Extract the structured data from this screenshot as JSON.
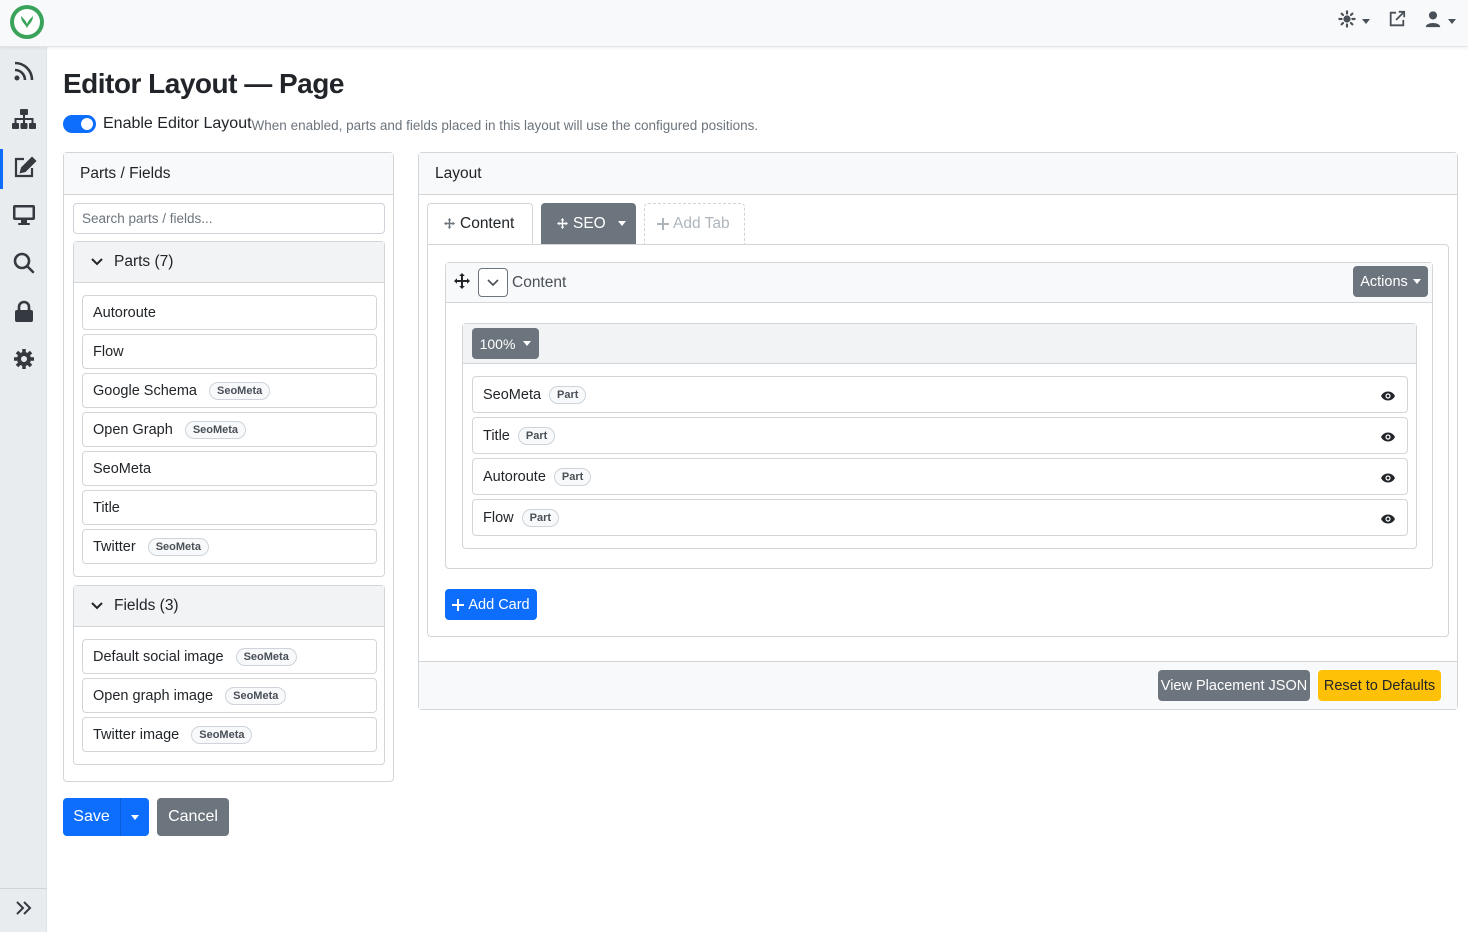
{
  "header": {
    "logo_icon": "orchard-logo-icon",
    "theme_icon": "theme-gear-icon",
    "external_icon": "external-link-icon",
    "user_icon": "user-icon"
  },
  "sidebar": {
    "items": [
      {
        "icon": "rss-icon"
      },
      {
        "icon": "sitemap-icon"
      },
      {
        "icon": "edit-icon",
        "active": true
      },
      {
        "icon": "desktop-icon"
      },
      {
        "icon": "search-icon"
      },
      {
        "icon": "lock-icon"
      },
      {
        "icon": "gear-icon"
      }
    ],
    "expand_icon": "double-chevron-right-icon"
  },
  "page": {
    "title": "Editor Layout — Page",
    "toggle_label": "Enable Editor Layout",
    "toggle_help": "When enabled, parts and fields placed in this layout will use the configured positions.",
    "toggle_on": true
  },
  "left_panel": {
    "title": "Parts / Fields",
    "search_placeholder": "Search parts / fields...",
    "parts_group": {
      "label": "Parts (7)",
      "items": [
        {
          "name": "Autoroute",
          "badge": ""
        },
        {
          "name": "Flow",
          "badge": ""
        },
        {
          "name": "Google Schema",
          "badge": "SeoMeta"
        },
        {
          "name": "Open Graph",
          "badge": "SeoMeta"
        },
        {
          "name": "SeoMeta",
          "badge": ""
        },
        {
          "name": "Title",
          "badge": ""
        },
        {
          "name": "Twitter",
          "badge": "SeoMeta"
        }
      ]
    },
    "fields_group": {
      "label": "Fields (3)",
      "items": [
        {
          "name": "Default social image",
          "badge": "SeoMeta"
        },
        {
          "name": "Open graph image",
          "badge": "SeoMeta"
        },
        {
          "name": "Twitter image",
          "badge": "SeoMeta"
        }
      ]
    }
  },
  "form_buttons": {
    "save": "Save",
    "cancel": "Cancel"
  },
  "right_panel": {
    "title": "Layout",
    "tabs": [
      {
        "label": "Content",
        "active": true
      },
      {
        "label": "SEO",
        "active": false
      }
    ],
    "add_tab": "Add Tab",
    "card": {
      "title": "Content",
      "actions": "Actions",
      "column_width": "100%",
      "placed": [
        {
          "name": "SeoMeta",
          "badge": "Part"
        },
        {
          "name": "Title",
          "badge": "Part"
        },
        {
          "name": "Autoroute",
          "badge": "Part"
        },
        {
          "name": "Flow",
          "badge": "Part"
        }
      ]
    },
    "add_card": "Add Card",
    "view_json": "View Placement JSON",
    "reset": "Reset to Defaults"
  },
  "colors": {
    "primary": "#0d6efd",
    "secondary": "#6c757d",
    "warning": "#ffc107",
    "brand": "#3aa35a"
  }
}
